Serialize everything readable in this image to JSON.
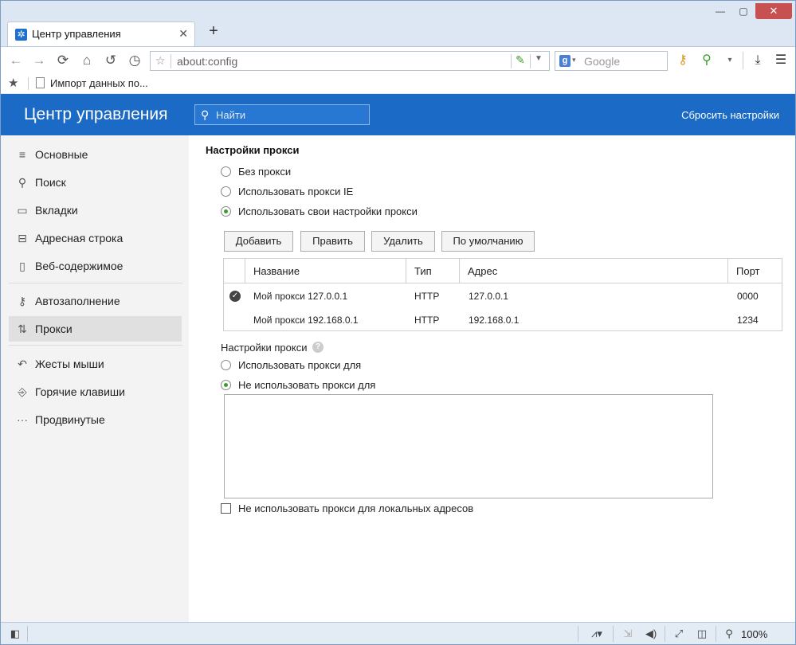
{
  "window": {
    "minimize": "—",
    "maximize": "▢",
    "close": "✕"
  },
  "tab": {
    "title": "Центр управления",
    "close": "✕",
    "new_tab": "+"
  },
  "address_bar": {
    "url": "about:config"
  },
  "search_bar": {
    "placeholder": "Google",
    "engine_icon": "g"
  },
  "bookmarks": {
    "items": [
      {
        "label": "Импорт данных по..."
      }
    ]
  },
  "header": {
    "title": "Центр управления",
    "search_placeholder": "Найти",
    "reset": "Сбросить настройки"
  },
  "sidebar": {
    "items": [
      {
        "label": "Основные",
        "icon": "sliders-icon",
        "glyph": "≡"
      },
      {
        "label": "Поиск",
        "icon": "search-icon",
        "glyph": "⚲"
      },
      {
        "label": "Вкладки",
        "icon": "tabs-icon",
        "glyph": "▭"
      },
      {
        "label": "Адресная строка",
        "icon": "address-bar-icon",
        "glyph": "⊟"
      },
      {
        "label": "Веб-содержимое",
        "icon": "page-icon",
        "glyph": "▯"
      },
      {
        "label": "Автозаполнение",
        "icon": "key-icon",
        "glyph": "⚷"
      },
      {
        "label": "Прокси",
        "icon": "proxy-icon",
        "glyph": "⇅"
      },
      {
        "label": "Жесты мыши",
        "icon": "gesture-icon",
        "glyph": "↶"
      },
      {
        "label": "Горячие клавиши",
        "icon": "hotkey-icon",
        "glyph": "⎆"
      },
      {
        "label": "Продвинутые",
        "icon": "more-icon",
        "glyph": "···"
      }
    ],
    "active_index": 6
  },
  "proxy": {
    "section_title": "Настройки прокси",
    "modes": [
      {
        "label": "Без прокси",
        "selected": false
      },
      {
        "label": "Использовать прокси IE",
        "selected": false
      },
      {
        "label": "Использовать свои настройки прокси",
        "selected": true
      }
    ],
    "buttons": {
      "add": "Добавить",
      "edit": "Править",
      "delete": "Удалить",
      "default": "По умолчанию"
    },
    "table": {
      "headers": [
        "Название",
        "Тип",
        "Адрес",
        "Порт"
      ],
      "rows": [
        {
          "checked": true,
          "name": "Мой прокси 127.0.0.1",
          "type": "HTTP",
          "address": "127.0.0.1",
          "port": "0000"
        },
        {
          "checked": false,
          "name": "Мой прокси 192.168.0.1",
          "type": "HTTP",
          "address": "192.168.0.1",
          "port": "1234"
        }
      ]
    },
    "exceptions_title": "Настройки прокси",
    "exception_modes": [
      {
        "label": "Использовать прокси для",
        "selected": false
      },
      {
        "label": "Не использовать прокси для",
        "selected": true
      }
    ],
    "exception_list": "",
    "local_bypass_label": "Не использовать прокси для локальных адресов",
    "local_bypass_checked": false
  },
  "statusbar": {
    "zoom": "100%"
  }
}
